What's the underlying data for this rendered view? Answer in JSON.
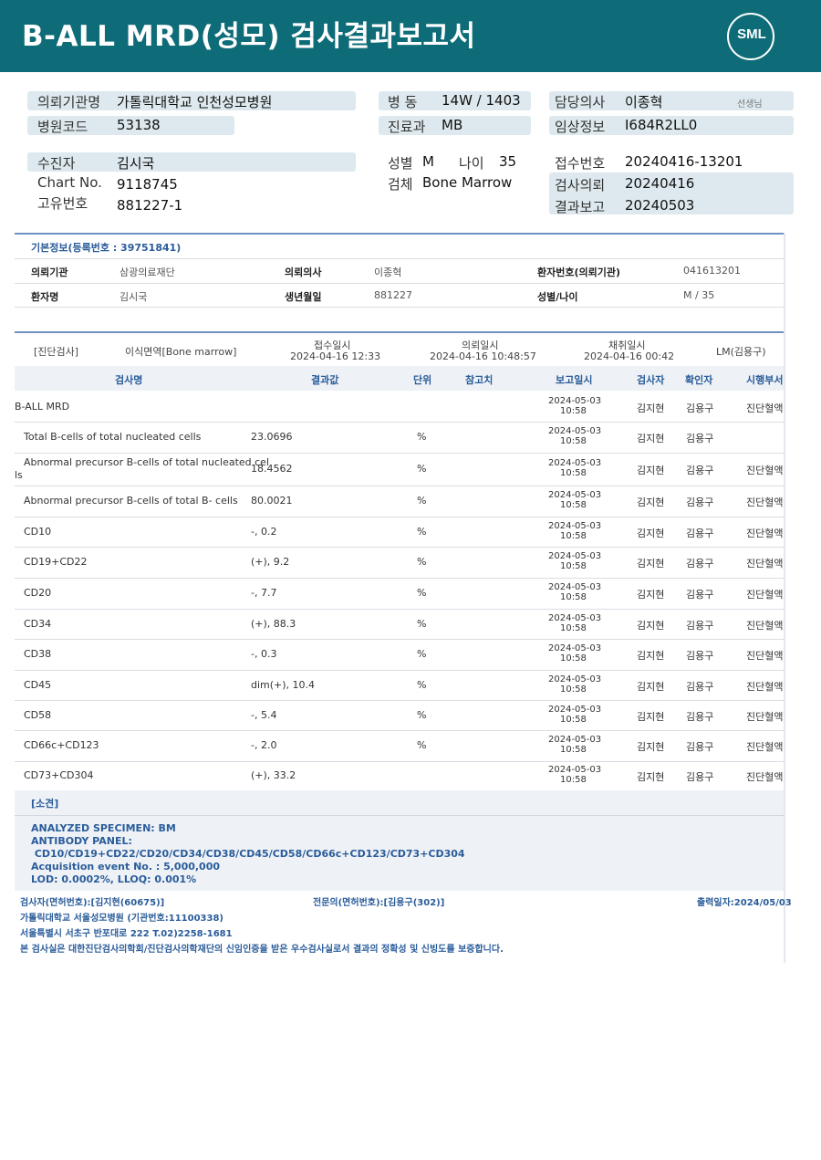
{
  "header": {
    "title": "B-ALL  MRD(성모) 검사결과보고서",
    "logo": "SML",
    "colors": {
      "band": "#0e6c78",
      "accent": "#2a5c9a",
      "label_bar": "#dde9ee"
    }
  },
  "info": {
    "institution_label": "의뢰기관명",
    "institution": "가톨릭대학교 인천성모병원",
    "hospital_code_label": "병원코드",
    "hospital_code": "53138",
    "ward_label": "병  동",
    "ward": "14W / 1403",
    "dept_label": "진료과",
    "dept": "MB",
    "doctor_label": "담당의사",
    "doctor": "이종혁",
    "doctor_suffix": "선생님",
    "clinical_label": "임상정보",
    "clinical": "I684R2LL0",
    "patient_label": "수진자",
    "patient": "김시국",
    "chart_label": "Chart No.",
    "chart": "9118745",
    "uid_label": "고유번호",
    "uid": "881227-1",
    "sex_label": "성별",
    "sex": "M",
    "age_label": "나이",
    "age": "35",
    "specimen_label": "검체",
    "specimen": "Bone Marrow",
    "receipt_label": "접수번호",
    "receipt": "20240416-13201",
    "request_label": "검사의뢰",
    "request": "20240416",
    "report_label": "결과보고",
    "report": "20240503"
  },
  "basic": {
    "title": "기본정보(등록번호 : 39751841)",
    "r1": [
      "의뢰기관",
      "삼광의료재단",
      "의뢰의사",
      "이종혁",
      "환자번호(의뢰기관)",
      "041613201"
    ],
    "r2": [
      "환자명",
      "김시국",
      "생년월일",
      "881227",
      "성별/나이",
      "M / 35"
    ]
  },
  "diag": {
    "category": "[진단검사]",
    "specimen": "이식면역[Bone marrow]",
    "received_label": "접수일시",
    "received": "2024-04-16 12:33",
    "requested_label": "의뢰일시",
    "requested": "2024-04-16 10:48:57",
    "collected_label": "채취일시",
    "collected": "2024-04-16 00:42",
    "reviewer": "LM(김용구)"
  },
  "table": {
    "headers": [
      "검사명",
      "결과값",
      "단위",
      "참고치",
      "보고일시",
      "검사자",
      "확인자",
      "시행부서"
    ],
    "rows": [
      {
        "name": "B-ALL MRD",
        "result": "",
        "unit": "",
        "date": "2024-05-03",
        "time": "10:58",
        "tester": "김지현",
        "confirmer": "김용구",
        "dept": "진단혈액"
      },
      {
        "name": "Total B-cells of total nucleated cells",
        "result": "23.0696",
        "unit": "%",
        "date": "2024-05-03",
        "time": "10:58",
        "tester": "김지현",
        "confirmer": "김용구",
        "dept": ""
      },
      {
        "name": "Abnormal precursor B-cells of total nucleated cel",
        "name2": "ls",
        "result": "18.4562",
        "unit": "%",
        "date": "2024-05-03",
        "time": "10:58",
        "tester": "김지현",
        "confirmer": "김용구",
        "dept": "진단혈액"
      },
      {
        "name": "Abnormal precursor B-cells of total B- cells",
        "result": "80.0021",
        "unit": "%",
        "date": "2024-05-03",
        "time": "10:58",
        "tester": "김지현",
        "confirmer": "김용구",
        "dept": "진단혈액"
      },
      {
        "name": "CD10",
        "result": "-, 0.2",
        "unit": "%",
        "date": "2024-05-03",
        "time": "10:58",
        "tester": "김지현",
        "confirmer": "김용구",
        "dept": "진단혈액"
      },
      {
        "name": "CD19+CD22",
        "result": "(+), 9.2",
        "unit": "%",
        "date": "2024-05-03",
        "time": "10:58",
        "tester": "김지현",
        "confirmer": "김용구",
        "dept": "진단혈액"
      },
      {
        "name": "CD20",
        "result": "-, 7.7",
        "unit": "%",
        "date": "2024-05-03",
        "time": "10:58",
        "tester": "김지현",
        "confirmer": "김용구",
        "dept": "진단혈액"
      },
      {
        "name": "CD34",
        "result": "(+), 88.3",
        "unit": "%",
        "date": "2024-05-03",
        "time": "10:58",
        "tester": "김지현",
        "confirmer": "김용구",
        "dept": "진단혈액"
      },
      {
        "name": "CD38",
        "result": "-, 0.3",
        "unit": "%",
        "date": "2024-05-03",
        "time": "10:58",
        "tester": "김지현",
        "confirmer": "김용구",
        "dept": "진단혈액"
      },
      {
        "name": "CD45",
        "result": "dim(+), 10.4",
        "unit": "%",
        "date": "2024-05-03",
        "time": "10:58",
        "tester": "김지현",
        "confirmer": "김용구",
        "dept": "진단혈액"
      },
      {
        "name": "CD58",
        "result": "-, 5.4",
        "unit": "%",
        "date": "2024-05-03",
        "time": "10:58",
        "tester": "김지현",
        "confirmer": "김용구",
        "dept": "진단혈액"
      },
      {
        "name": "CD66c+CD123",
        "result": "-, 2.0",
        "unit": "%",
        "date": "2024-05-03",
        "time": "10:58",
        "tester": "김지현",
        "confirmer": "김용구",
        "dept": "진단혈액"
      },
      {
        "name": "CD73+CD304",
        "result": "(+), 33.2",
        "unit": "",
        "date": "2024-05-03",
        "time": "10:58",
        "tester": "김지현",
        "confirmer": "김용구",
        "dept": "진단혈액"
      }
    ]
  },
  "comment": {
    "title": "[소견]",
    "lines": [
      "ANALYZED SPECIMEN: BM",
      "ANTIBODY PANEL:",
      " CD10/CD19+CD22/CD20/CD34/CD38/CD45/CD58/CD66c+CD123/CD73+CD304",
      "Acquisition event No. : 5,000,000",
      "LOD: 0.0002%, LLOQ: 0.001%"
    ]
  },
  "footer": {
    "tester": "검사자(면허번호):[김지현(60675)]",
    "specialist": "전문의(면허번호):[김용구(302)]",
    "printed": "출력일자:2024/05/03",
    "lab": "가톨릭대학교 서울성모병원 (기관번호:11100338)",
    "address": "서울특별시 서초구 반포대로 222 T.02)2258-1681",
    "cert": "본 검사실은 대한진단검사의학회/진단검사의학재단의 신임인증을 받은 우수검사실로서 결과의 정확성 및 신빙도를 보증합니다."
  }
}
